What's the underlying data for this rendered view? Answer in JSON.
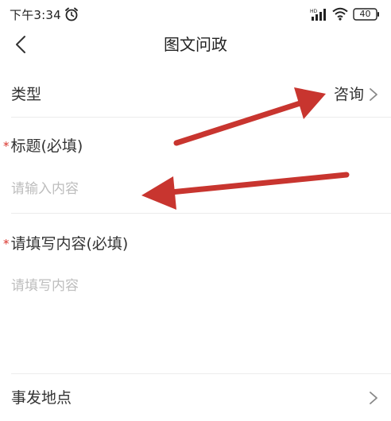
{
  "status_bar": {
    "time": "下午3:34",
    "battery": "40",
    "network_label": "HD"
  },
  "nav": {
    "title": "图文问政"
  },
  "form": {
    "type_row": {
      "label": "类型",
      "value": "咨询"
    },
    "title_field": {
      "label": "标题(必填)",
      "placeholder": "请输入内容",
      "required_mark": "*"
    },
    "content_field": {
      "label": "请填写内容(必填)",
      "placeholder": "请填写内容",
      "required_mark": "*"
    },
    "location_row": {
      "label": "事发地点"
    }
  },
  "colors": {
    "required": "#d9332b",
    "annotation_arrow": "#c8352f",
    "placeholder": "#bdbdbd",
    "divider": "#ececec"
  },
  "icons": [
    "alarm-clock-icon",
    "cellular-signal-icon",
    "wifi-icon",
    "battery-icon",
    "back-chevron-icon",
    "chevron-right-icon"
  ]
}
